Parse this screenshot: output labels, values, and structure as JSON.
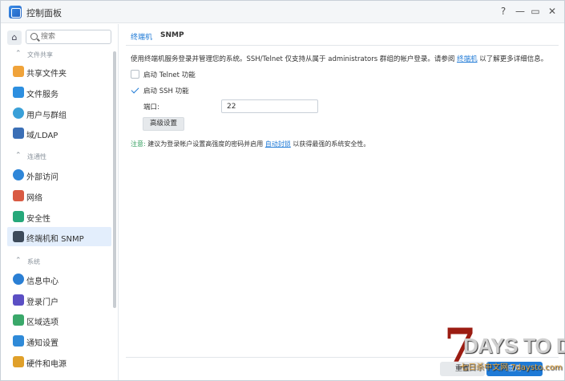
{
  "window": {
    "title": "控制面板"
  },
  "controls": {
    "help": "?",
    "minimize": "—",
    "maximize": "▭",
    "close": "✕"
  },
  "search": {
    "placeholder": "搜索"
  },
  "sidebar": {
    "groups": [
      {
        "label": "文件共享",
        "items": [
          "共享文件夹",
          "文件服务",
          "用户与群组",
          "域/LDAP"
        ]
      },
      {
        "label": "连通性",
        "items": [
          "外部访问",
          "网络",
          "安全性",
          "终端机和 SNMP"
        ]
      },
      {
        "label": "系统",
        "items": [
          "信息中心",
          "登录门户",
          "区域选项",
          "通知设置",
          "硬件和电源"
        ]
      }
    ],
    "active_item": "终端机和 SNMP"
  },
  "tabs": [
    {
      "label": "终端机",
      "active": true
    },
    {
      "label": "SNMP",
      "active": false
    }
  ],
  "content": {
    "desc_prefix": "使用终端机服务登录并管理您的系统。SSH/Telnet 仅支持从属于 administrators 群组的帐户登录。请参阅",
    "desc_link": "终端机",
    "desc_suffix": "以了解更多详细信息。",
    "telnet_label": "启动 Telnet 功能",
    "telnet_checked": false,
    "ssh_label": "启动 SSH 功能",
    "ssh_checked": true,
    "port_label": "端口:",
    "port_value": "22",
    "advanced_button": "高级设置",
    "note_label": "注意:",
    "note_prefix": "建议为登录帐户设置高强度的密码并启用",
    "note_link": "自动封锁",
    "note_suffix": "以获得最强的系统安全性。"
  },
  "footer": {
    "reset_label": "重置",
    "apply_label": "应用"
  },
  "watermark": {
    "seven": "7",
    "title": "DAYS TO DIE",
    "subtitle": "七日杀中文网 7daysto.com"
  },
  "colors": {
    "accent": "#1f7ad6",
    "active_bg": "#e3eefc",
    "note": "#2e9c5a"
  }
}
